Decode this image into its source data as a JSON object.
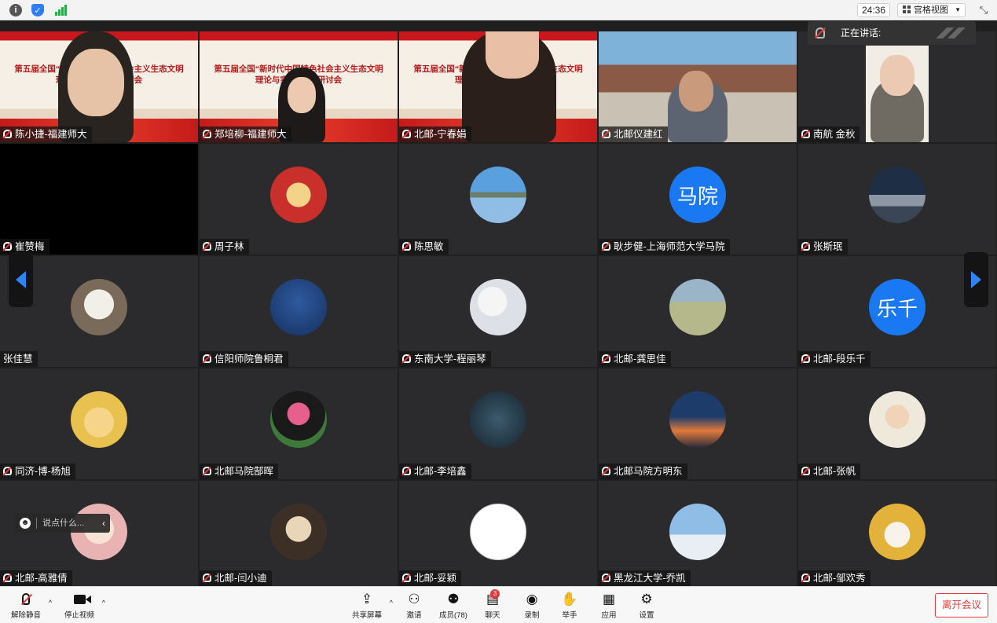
{
  "topbar": {
    "timer": "24:36",
    "view_label": "宫格视图",
    "icons": [
      "info-icon",
      "shield-icon",
      "signal-icon",
      "fullscreen-icon"
    ]
  },
  "speaking": {
    "label": "正在讲话:"
  },
  "banner_text": "第五届全国“新时代中国特色社会主义生态文明理论与实践”学术研讨会",
  "participants": [
    {
      "name": "陈小捷-福建师大",
      "kind": "video",
      "muted": true
    },
    {
      "name": "郑培柳-福建师大",
      "kind": "video",
      "muted": true
    },
    {
      "name": "北邮-宁春娟",
      "kind": "video",
      "muted": true
    },
    {
      "name": "北邮仪建红",
      "kind": "video",
      "muted": true
    },
    {
      "name": "南航 金秋",
      "kind": "video",
      "muted": true
    },
    {
      "name": "崔赞梅",
      "kind": "black",
      "muted": true
    },
    {
      "name": "周子林",
      "kind": "avatar",
      "color": "#c9302c",
      "muted": true
    },
    {
      "name": "陈思敏",
      "kind": "avatar",
      "color": "#4f8fc9",
      "muted": true
    },
    {
      "name": "耿步健-上海师范大学马院",
      "kind": "text",
      "avatar_text": "马院",
      "muted": true
    },
    {
      "name": "张斯珉",
      "kind": "avatar",
      "color": "#334a63",
      "muted": true
    },
    {
      "name": "张佳慧",
      "kind": "avatar",
      "color": "#8a7a6a",
      "muted": false
    },
    {
      "name": "信阳师院鲁桐君",
      "kind": "avatar",
      "color": "#1c3a6e",
      "muted": true
    },
    {
      "name": "东南大学-程丽琴",
      "kind": "avatar",
      "color": "#e5e7ec",
      "muted": true
    },
    {
      "name": "北邮-龚思佳",
      "kind": "avatar",
      "color": "#a9b07a",
      "muted": true
    },
    {
      "name": "北邮-段乐千",
      "kind": "text",
      "avatar_text": "乐千",
      "muted": true
    },
    {
      "name": "同济-博-杨旭",
      "kind": "avatar",
      "color": "#e5c15a",
      "muted": true
    },
    {
      "name": "北邮马院郜晖",
      "kind": "avatar",
      "color": "#d8607a",
      "muted": true
    },
    {
      "name": "北邮-李培鑫",
      "kind": "avatar",
      "color": "#233544",
      "muted": true
    },
    {
      "name": "北邮马院方明东",
      "kind": "avatar",
      "color": "#c9663c",
      "muted": true
    },
    {
      "name": "北邮-张帆",
      "kind": "avatar",
      "color": "#efe9dc",
      "muted": true
    },
    {
      "name": "北邮-高雅倩",
      "kind": "avatar",
      "color": "#f0d6d0",
      "muted": true
    },
    {
      "name": "北邮-闫小迪",
      "kind": "avatar",
      "color": "#6b5a45",
      "muted": true
    },
    {
      "name": "北邮-妥颖",
      "kind": "avatar",
      "color": "#ffffff",
      "muted": true
    },
    {
      "name": "黑龙江大学-乔凯",
      "kind": "avatar",
      "color": "#9cc3e6",
      "muted": true
    },
    {
      "name": "北邮-邹欢秀",
      "kind": "avatar",
      "color": "#e2b23a",
      "muted": true
    }
  ],
  "chat": {
    "placeholder": "说点什么..."
  },
  "toolbar": {
    "unmute": "解除静音",
    "stop_video": "停止视频",
    "share": "共享屏幕",
    "invite": "邀请",
    "members": "成员(78)",
    "chat": "聊天",
    "chat_badge": "3",
    "record": "录制",
    "raise_hand": "举手",
    "apps": "应用",
    "settings": "设置",
    "leave": "离开会议"
  },
  "colors": {
    "accent": "#1978f2",
    "leave": "#e03a3a",
    "tile": "#2b2b2d"
  }
}
